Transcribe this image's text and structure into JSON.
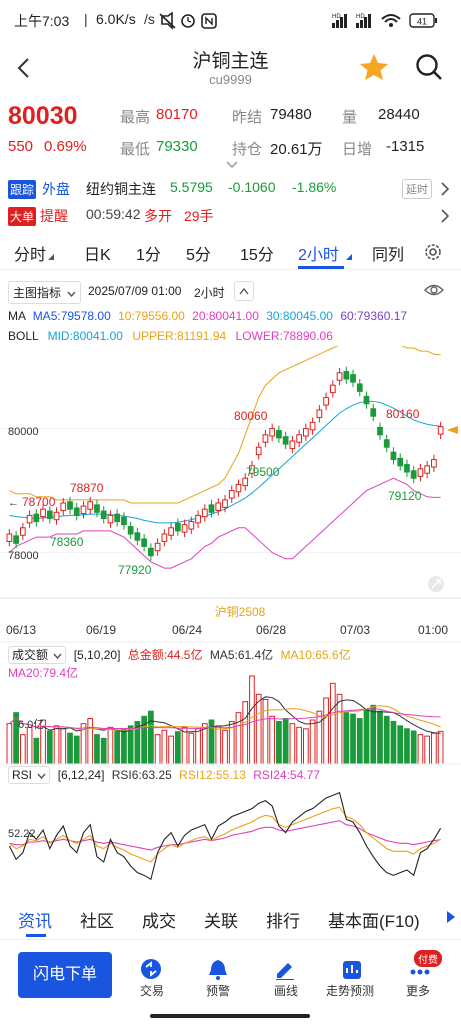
{
  "status_bar": {
    "time": "上午7:03",
    "speed": "6.0K/s",
    "battery": "41",
    "signal1": "HD",
    "signal2": "HD"
  },
  "nav": {
    "title": "沪铜主连",
    "code": "cu9999"
  },
  "quote": {
    "price": "80030",
    "change": "550",
    "change_pct": "0.69%",
    "high_label": "最高",
    "high_value": "80170",
    "low_label": "最低",
    "low_value": "79330",
    "prev_settle_label": "昨结",
    "prev_settle_value": "79480",
    "open_interest_label": "持仓",
    "open_interest_value": "20.61万",
    "volume_label": "量",
    "volume_value": "28440",
    "daily_increase_label": "日增",
    "daily_increase_value": "-1315"
  },
  "follow_row": {
    "tag1": "跟踪",
    "tag2": "外盘",
    "name": "纽约铜主连",
    "price": "5.5795",
    "change": "-0.1060",
    "change_pct": "-1.86%",
    "delay": "延时"
  },
  "big_order_row": {
    "tag1": "大单",
    "tag2": "提醒",
    "time": "00:59:42",
    "action": "多开",
    "lots": "29手"
  },
  "period_tabs": [
    {
      "label": "分时",
      "active": false
    },
    {
      "label": "日K",
      "active": false
    },
    {
      "label": "1分",
      "active": false
    },
    {
      "label": "5分",
      "active": false
    },
    {
      "label": "15分",
      "active": false
    },
    {
      "label": "2小时",
      "active": true
    },
    {
      "label": "同列",
      "active": false
    }
  ],
  "indicator_bar": {
    "main_indicator": "主图指标",
    "datetime": "2025/07/09 01:00",
    "period": "2小时"
  },
  "ma_legend": {
    "title": "MA",
    "ma5": "MA5:79578.00",
    "ma10": "10:79556.00",
    "ma20": "20:80041.00",
    "ma30": "30:80045.00",
    "ma60": "60:79360.17"
  },
  "boll_legend": {
    "title": "BOLL",
    "mid": "MID:80041.00",
    "upper": "UPPER:81191.94",
    "lower": "LOWER:78890.06"
  },
  "chart_labels": {
    "y_tick_80000": "80000",
    "y_tick_78000": "78000",
    "contract": "沪铜2508",
    "x_ticks": [
      "06/13",
      "06/19",
      "06/24",
      "06/28",
      "07/03",
      "01:00"
    ],
    "annotations": [
      "78700",
      "78870",
      "78360",
      "77920",
      "80060",
      "79500",
      "80160",
      "79120"
    ]
  },
  "volume_panel": {
    "name": "成交额",
    "params": "[5,10,20]",
    "total": "总金额:44.5亿",
    "ma5": "MA5:61.4亿",
    "ma10": "MA10:65.6亿",
    "ma20": "MA20:79.4亿",
    "tick": "6.0亿"
  },
  "rsi_panel": {
    "name": "RSI",
    "params": "[6,12,24]",
    "rsi6": "RSI6:63.25",
    "rsi12": "RSI12:55.13",
    "rsi24": "RSI24:54.77",
    "tick": "52.22"
  },
  "bottom_tabs": [
    {
      "label": "资讯",
      "active": true
    },
    {
      "label": "社区",
      "active": false
    },
    {
      "label": "成交",
      "active": false
    },
    {
      "label": "关联",
      "active": false
    },
    {
      "label": "排行",
      "active": false
    },
    {
      "label": "基本面(F10)",
      "active": false
    }
  ],
  "footer": {
    "quick_order": "闪电下单",
    "items": [
      {
        "label": "交易",
        "icon": "trade-icon"
      },
      {
        "label": "预警",
        "icon": "bell-icon"
      },
      {
        "label": "画线",
        "icon": "pen-icon"
      },
      {
        "label": "走势预测",
        "icon": "trend-forecast-icon"
      },
      {
        "label": "更多",
        "icon": "more-icon"
      }
    ],
    "paid_badge": "付费"
  },
  "colors": {
    "up": "#e02020",
    "down": "#1a9a3a",
    "accent": "#1a55e0",
    "ma5": "#333333",
    "ma10": "#e8a317",
    "ma20": "#e040c0",
    "ma30": "#17a2d8",
    "ma60": "#7b3fc8",
    "boll_mid": "#17a2d8",
    "boll_upper": "#e8a317",
    "boll_lower": "#e040c0"
  },
  "chart_data": {
    "type": "candlestick",
    "title": "沪铜2508",
    "period": "2小时",
    "x_ticks": [
      "06/13",
      "06/19",
      "06/24",
      "06/28",
      "07/03",
      "01:00"
    ],
    "y_ticks": [
      78000,
      80000
    ],
    "ylim": [
      77300,
      81300
    ],
    "annotations": [
      {
        "label": "78700",
        "value": 78700
      },
      {
        "label": "78870",
        "value": 78870
      },
      {
        "label": "78360",
        "value": 78360
      },
      {
        "label": "77920",
        "value": 77920
      },
      {
        "label": "80060",
        "value": 80060
      },
      {
        "label": "79500",
        "value": 79500
      },
      {
        "label": "80160",
        "value": 80160
      },
      {
        "label": "79120",
        "value": 79120
      }
    ],
    "candles_close": [
      78300,
      78150,
      78400,
      78600,
      78500,
      78700,
      78550,
      78650,
      78800,
      78700,
      78600,
      78750,
      78820,
      78650,
      78550,
      78600,
      78500,
      78450,
      78300,
      78200,
      78100,
      77950,
      78150,
      78300,
      78400,
      78350,
      78450,
      78500,
      78600,
      78700,
      78650,
      78800,
      78850,
      79000,
      79100,
      79200,
      79400,
      79700,
      79900,
      80000,
      79850,
      79750,
      79800,
      79900,
      80000,
      80100,
      80300,
      80500,
      80700,
      80900,
      80800,
      80750,
      80600,
      80400,
      80200,
      79900,
      79700,
      79500,
      79400,
      79300,
      79200,
      79350,
      79400,
      79500,
      80030
    ],
    "bull": [
      true,
      false,
      true,
      true,
      false,
      true,
      false,
      true,
      true,
      false,
      false,
      true,
      true,
      false,
      false,
      true,
      false,
      false,
      false,
      false,
      false,
      false,
      true,
      true,
      true,
      false,
      true,
      true,
      true,
      true,
      false,
      true,
      true,
      true,
      true,
      true,
      true,
      true,
      true,
      true,
      false,
      false,
      true,
      true,
      true,
      true,
      true,
      true,
      true,
      true,
      false,
      false,
      false,
      false,
      false,
      false,
      false,
      false,
      false,
      false,
      false,
      true,
      true,
      true,
      true
    ],
    "boll_upper": [
      79000,
      78950,
      78950,
      78950,
      78900,
      78900,
      78900,
      78850,
      78850,
      78850,
      78850,
      78850,
      78850,
      78850,
      78850,
      78850,
      78850,
      78850,
      78800,
      78800,
      78800,
      78800,
      78800,
      78800,
      78800,
      78800,
      78850,
      78900,
      78950,
      79000,
      79050,
      79100,
      79200,
      79400,
      79600,
      79900,
      80200,
      80500,
      80700,
      80800,
      80900,
      80950,
      81000,
      81050,
      81100,
      81150,
      81200,
      81250,
      81300,
      81350,
      81400,
      81400,
      81400,
      81400,
      81400,
      81400,
      81400,
      81400,
      81350,
      81300,
      81300,
      81250,
      81250,
      81200,
      81190
    ],
    "boll_mid": [
      78600,
      78580,
      78570,
      78560,
      78550,
      78560,
      78570,
      78580,
      78590,
      78600,
      78600,
      78610,
      78620,
      78620,
      78620,
      78610,
      78600,
      78590,
      78570,
      78550,
      78520,
      78500,
      78480,
      78480,
      78480,
      78490,
      78510,
      78530,
      78560,
      78590,
      78620,
      78660,
      78700,
      78760,
      78820,
      78880,
      78960,
      79050,
      79150,
      79250,
      79350,
      79450,
      79550,
      79650,
      79750,
      79850,
      79950,
      80050,
      80150,
      80250,
      80320,
      80380,
      80420,
      80440,
      80440,
      80420,
      80380,
      80330,
      80270,
      80200,
      80140,
      80100,
      80070,
      80050,
      80040
    ],
    "boll_lower": [
      78000,
      78100,
      78150,
      78200,
      78250,
      78250,
      78250,
      78300,
      78300,
      78300,
      78300,
      78350,
      78350,
      78350,
      78350,
      78350,
      78300,
      78250,
      78150,
      78050,
      77950,
      77850,
      77800,
      77750,
      77750,
      77800,
      77850,
      77900,
      78000,
      78100,
      78150,
      78250,
      78300,
      78350,
      78400,
      78400,
      78300,
      78200,
      78100,
      78000,
      77950,
      77900,
      77900,
      78000,
      78100,
      78200,
      78300,
      78400,
      78500,
      78600,
      78700,
      78800,
      78900,
      79000,
      79050,
      79100,
      79150,
      79200,
      79150,
      79100,
      79000,
      78950,
      78900,
      78890,
      78890
    ],
    "volume": [
      55,
      70,
      40,
      50,
      35,
      60,
      45,
      52,
      48,
      42,
      38,
      55,
      62,
      40,
      35,
      50,
      45,
      48,
      52,
      58,
      65,
      72,
      40,
      46,
      38,
      44,
      50,
      42,
      48,
      55,
      60,
      52,
      46,
      58,
      70,
      85,
      120,
      95,
      88,
      65,
      58,
      62,
      55,
      50,
      48,
      60,
      72,
      90,
      110,
      95,
      70,
      68,
      62,
      75,
      80,
      72,
      65,
      58,
      52,
      48,
      45,
      40,
      38,
      42,
      44.5
    ],
    "rsi6": [
      50,
      40,
      45,
      60,
      55,
      62,
      48,
      58,
      65,
      50,
      45,
      60,
      66,
      42,
      38,
      55,
      45,
      42,
      35,
      30,
      28,
      25,
      45,
      55,
      60,
      50,
      58,
      62,
      64,
      66,
      55,
      65,
      68,
      72,
      74,
      76,
      78,
      82,
      84,
      80,
      65,
      60,
      68,
      72,
      76,
      78,
      82,
      86,
      88,
      90,
      70,
      68,
      60,
      50,
      42,
      35,
      30,
      28,
      30,
      32,
      28,
      45,
      48,
      55,
      63.25
    ],
    "rsi12": [
      52,
      48,
      50,
      55,
      54,
      57,
      52,
      55,
      58,
      54,
      52,
      55,
      58,
      50,
      48,
      52,
      49,
      47,
      44,
      42,
      40,
      38,
      44,
      48,
      51,
      49,
      52,
      54,
      56,
      57,
      54,
      57,
      59,
      62,
      64,
      66,
      68,
      71,
      73,
      72,
      66,
      64,
      66,
      68,
      70,
      72,
      74,
      76,
      78,
      79,
      72,
      70,
      66,
      60,
      56,
      52,
      48,
      46,
      46,
      46,
      44,
      48,
      50,
      52,
      55.13
    ],
    "rsi24": [
      52,
      51,
      51,
      53,
      53,
      54,
      53,
      54,
      55,
      54,
      53,
      54,
      55,
      53,
      52,
      53,
      52,
      51,
      50,
      49,
      48,
      47,
      49,
      50,
      51,
      51,
      52,
      53,
      54,
      55,
      54,
      55,
      56,
      58,
      59,
      60,
      61,
      63,
      64,
      64,
      62,
      61,
      62,
      63,
      64,
      65,
      66,
      67,
      68,
      69,
      66,
      65,
      63,
      60,
      58,
      56,
      54,
      53,
      52,
      52,
      51,
      52,
      53,
      54,
      54.77
    ]
  }
}
